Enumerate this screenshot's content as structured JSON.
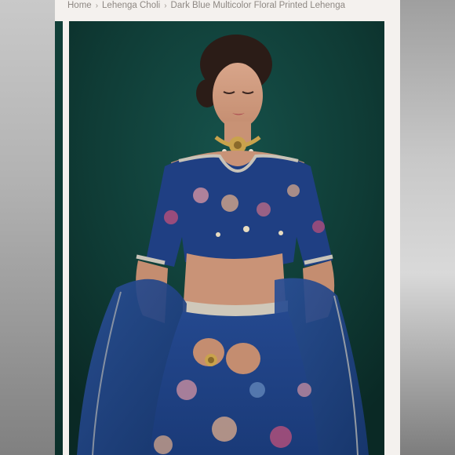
{
  "breadcrumb": {
    "items": [
      "Home",
      "Lehenga Choli",
      "Dark Blue Multicolor Floral Printed Lehenga"
    ],
    "separator": "›"
  },
  "product_image": {
    "alt": "Dark Blue Multicolor Floral Printed Lehenga",
    "background_color": "#0f3b35",
    "garment_color": "#1e3f80"
  }
}
